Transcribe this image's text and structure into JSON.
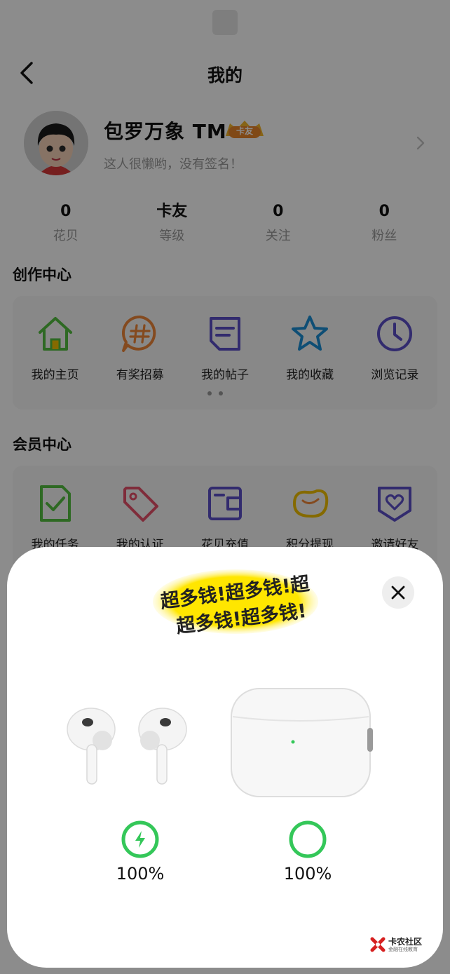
{
  "header": {
    "title": "我的"
  },
  "profile": {
    "username": "包罗万象 TM",
    "level_badge": "卡友",
    "signature": "这人很懒哟，没有签名！"
  },
  "stats": [
    {
      "value": "0",
      "label": "花贝"
    },
    {
      "value": "卡友",
      "label": "等级"
    },
    {
      "value": "0",
      "label": "关注"
    },
    {
      "value": "0",
      "label": "粉丝"
    }
  ],
  "creation_center": {
    "title": "创作中心",
    "items": [
      {
        "label": "我的主页",
        "icon": "home-icon",
        "color": "#55c040"
      },
      {
        "label": "有奖招募",
        "icon": "hashtag-chat-icon",
        "color": "#f0883a"
      },
      {
        "label": "我的帖子",
        "icon": "document-icon",
        "color": "#5b4fc8"
      },
      {
        "label": "我的收藏",
        "icon": "star-icon",
        "color": "#1a8fd6"
      },
      {
        "label": "浏览记录",
        "icon": "clock-icon",
        "color": "#5b4fc8"
      }
    ]
  },
  "member_center": {
    "title": "会员中心",
    "items": [
      {
        "label": "我的任务",
        "icon": "task-check-icon",
        "color": "#55c040"
      },
      {
        "label": "我的认证",
        "icon": "tag-icon",
        "color": "#e8506a"
      },
      {
        "label": "花贝充值",
        "icon": "wallet-icon",
        "color": "#5b4fc8"
      },
      {
        "label": "积分提现",
        "icon": "bean-icon",
        "color": "#f2c200"
      },
      {
        "label": "邀请好友",
        "icon": "heart-shield-icon",
        "color": "#5b4fc8"
      }
    ]
  },
  "popup": {
    "banner_line1": "超多钱!超多钱!超",
    "banner_line2": "超多钱!超多钱!",
    "earbuds_battery": "100%",
    "case_battery": "100%",
    "earbuds_battery_level": 1.0,
    "case_battery_level": 1.0,
    "status_color": "#34c759"
  },
  "watermark": {
    "brand": "卡农社区",
    "tagline": "金融在线教育"
  }
}
